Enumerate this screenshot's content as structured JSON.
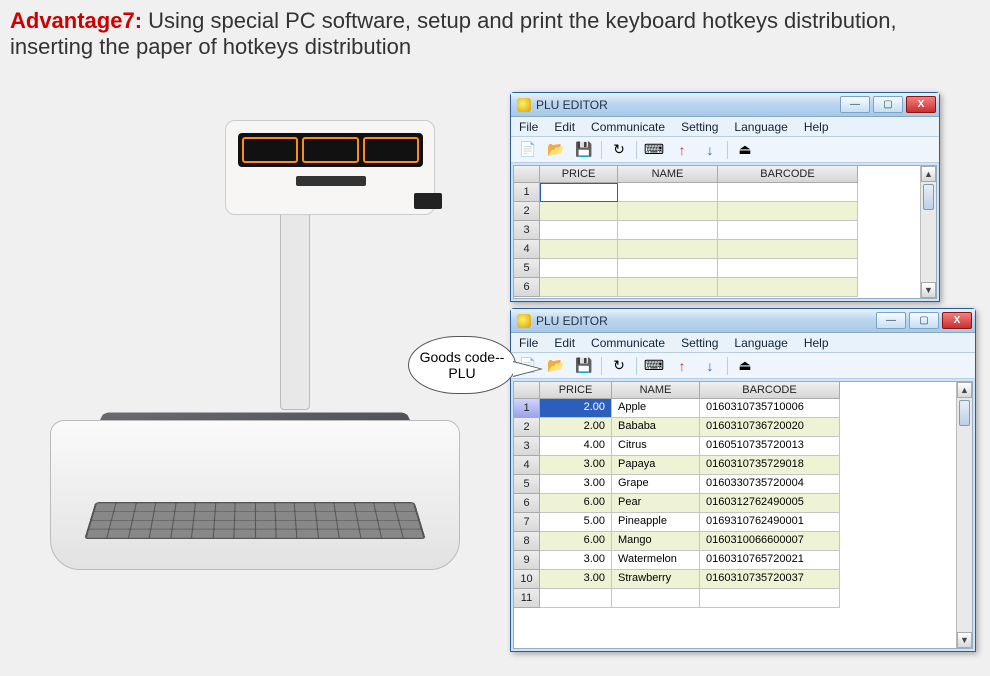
{
  "headline": {
    "tag": "Advantage7:",
    "text": " Using special PC software, setup and print the keyboard hotkeys distribution, inserting the paper of hotkeys distribution"
  },
  "bubble": "Goods code--PLU",
  "app_title": "PLU EDITOR",
  "winctrl": {
    "min": "—",
    "max": "▢",
    "close": "X"
  },
  "menu": {
    "file": "File",
    "edit": "Edit",
    "communicate": "Communicate",
    "setting": "Setting",
    "language": "Language",
    "help": "Help"
  },
  "columns": {
    "price": "PRICE",
    "name": "NAME",
    "barcode": "BARCODE"
  },
  "win1": {
    "empty_rows": [
      "1",
      "2",
      "3",
      "4",
      "5",
      "6"
    ]
  },
  "win2": {
    "rows": [
      {
        "n": "1",
        "price": "2.00",
        "name": "Apple",
        "barcode": "0160310735710006",
        "sel": true
      },
      {
        "n": "2",
        "price": "2.00",
        "name": "Bababa",
        "barcode": "0160310736720020"
      },
      {
        "n": "3",
        "price": "4.00",
        "name": "Citrus",
        "barcode": "0160510735720013"
      },
      {
        "n": "4",
        "price": "3.00",
        "name": "Papaya",
        "barcode": "0160310735729018"
      },
      {
        "n": "5",
        "price": "3.00",
        "name": "Grape",
        "barcode": "0160330735720004"
      },
      {
        "n": "6",
        "price": "6.00",
        "name": "Pear",
        "barcode": "0160312762490005"
      },
      {
        "n": "7",
        "price": "5.00",
        "name": "Pineapple",
        "barcode": "0169310762490001"
      },
      {
        "n": "8",
        "price": "6.00",
        "name": "Mango",
        "barcode": "0160310066600007"
      },
      {
        "n": "9",
        "price": "3.00",
        "name": "Watermelon",
        "barcode": "0160310765720021"
      },
      {
        "n": "10",
        "price": "3.00",
        "name": "Strawberry",
        "barcode": "0160310735720037"
      },
      {
        "n": "11",
        "price": "",
        "name": "",
        "barcode": ""
      }
    ]
  },
  "tool_icons": {
    "new": "📄",
    "open": "📂",
    "save": "💾",
    "refresh": "↻",
    "hotkey": "⌨",
    "up": "↑",
    "down": "↓",
    "exit": "⏏"
  }
}
